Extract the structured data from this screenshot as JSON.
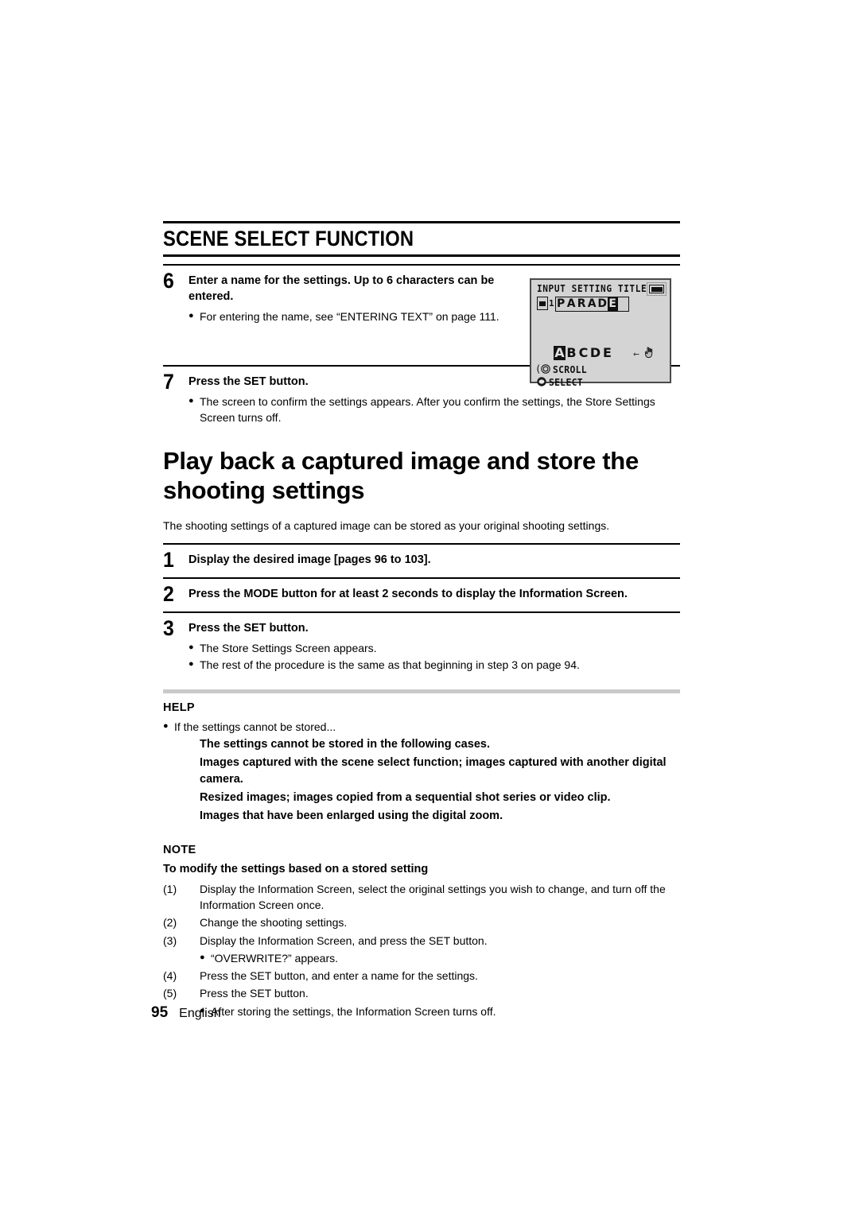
{
  "section": {
    "title": "SCENE SELECT FUNCTION"
  },
  "step6": {
    "number": "6",
    "lead": "Enter a name for the settings. Up to 6 characters can be entered.",
    "bullets": [
      "For entering the name, see “ENTERING TEXT” on page 111."
    ]
  },
  "lcd": {
    "title": "INPUT SETTING TITLE",
    "card_icon": "memory-card-icon",
    "slot_number": "1",
    "name_chars": [
      "P",
      "A",
      "R",
      "A",
      "D",
      "E",
      " "
    ],
    "cursor_index": 5,
    "alphabet": [
      "A",
      "B",
      "C",
      "D",
      "E"
    ],
    "alphabet_selected_index": 0,
    "arrow": "←",
    "hand_icon": "pointing-hand-icon",
    "scroll_label": "SCROLL",
    "select_label": "SELECT",
    "scroll_icon": "jog-dial-scroll-icon",
    "select_icon": "set-button-select-icon",
    "background_color": "#d4d4d4",
    "border_color": "#4a4a4a"
  },
  "step7": {
    "number": "7",
    "lead": "Press the SET button.",
    "bullets": [
      "The screen to confirm the settings appears. After you confirm the settings, the Store Settings Screen turns off."
    ]
  },
  "main_heading": "Play back a captured image and store the shooting settings",
  "intro_text": "The shooting settings of a captured image can be stored as your original shooting settings.",
  "step1": {
    "number": "1",
    "lead": "Display the desired image [pages 96 to 103]."
  },
  "step2": {
    "number": "2",
    "lead": "Press the MODE button for at least 2 seconds to display the Information Screen."
  },
  "step3": {
    "number": "3",
    "lead": "Press the SET button.",
    "bullets": [
      "The Store Settings Screen appears.",
      "The rest of the procedure is the same as that beginning in step 3 on page 94."
    ]
  },
  "help": {
    "label": "HELP",
    "bullet": "If the settings cannot be stored...",
    "subitems": [
      "The settings cannot be stored in the following cases.",
      "Images captured with the scene select function; images captured with another digital camera.",
      "Resized images; images copied from a sequential shot series or video clip.",
      "Images that have been enlarged using the digital zoom."
    ]
  },
  "note": {
    "label": "NOTE",
    "subtitle": "To modify the settings based on a stored setting",
    "items": [
      {
        "marker": "(1)",
        "text": "Display the Information Screen, select the original settings you wish to change, and turn off the Information Screen once."
      },
      {
        "marker": "(2)",
        "text": "Change the shooting settings."
      },
      {
        "marker": "(3)",
        "text": "Display the Information Screen, and press the SET button."
      }
    ],
    "sub_bullet_1": "“OVERWRITE?” appears.",
    "items2": [
      {
        "marker": "(4)",
        "text": "Press the SET button, and enter a name for the settings."
      },
      {
        "marker": "(5)",
        "text": "Press the SET button."
      }
    ],
    "sub_bullet_2": "After storing the settings, the Information Screen turns off."
  },
  "footer": {
    "page_number": "95",
    "language": "English"
  }
}
